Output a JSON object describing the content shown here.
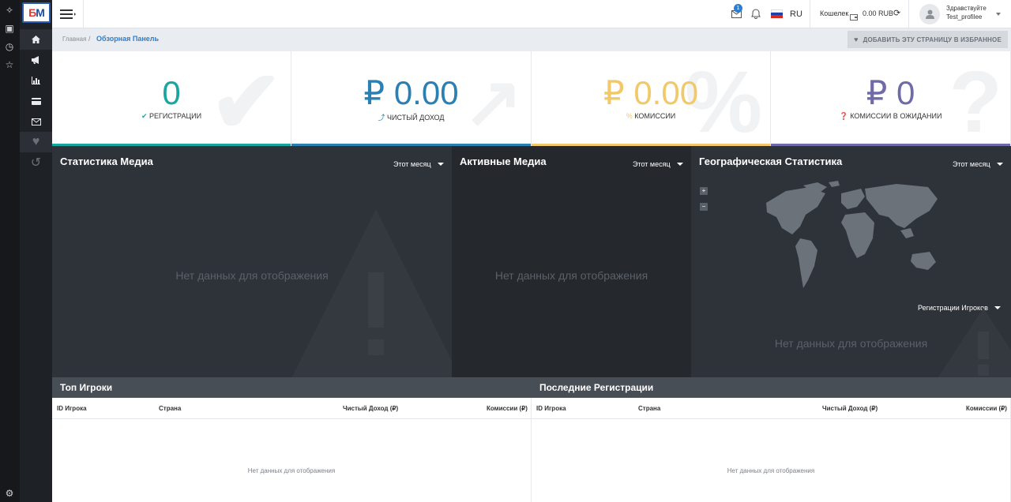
{
  "brand": {
    "logo_b": "Б",
    "logo_m": "M"
  },
  "topbar": {
    "mail_badge": "1",
    "language": "RU",
    "wallet_label": "Кошелек",
    "wallet_amount": "0.00 RUB",
    "greeting": "Здравствуйте",
    "username": "Test_profilee"
  },
  "breadcrumb": {
    "home": "Главная",
    "separator": "/",
    "current": "Обзорная Панель"
  },
  "favorite_button": "ДОБАВИТЬ ЭТУ СТРАНИЦУ В ИЗБРАННОЕ",
  "kpis": [
    {
      "value": "0",
      "label": "РЕГИСТРАЦИИ",
      "color": "#1aa6a0"
    },
    {
      "value": "₽ 0.00",
      "label": "ЧИСТЫЙ ДОХОД",
      "color": "#2a7fb3"
    },
    {
      "value": "₽ 0.00",
      "label": "КОМИССИИ",
      "color": "#f2c96a"
    },
    {
      "value": "₽ 0",
      "label": "КОМИССИИ В ОЖИДАНИИ",
      "color": "#6f6aa8"
    }
  ],
  "kpi_icons": {
    "reg": "✔",
    "income": "📈",
    "comm": "%",
    "pending": "?"
  },
  "panels": {
    "media_stats": {
      "title": "Статистика Медиа",
      "period": "Этот месяц",
      "empty": "Нет данных для отображения"
    },
    "active_media": {
      "title": "Активные Медиа",
      "period": "Этот месяц",
      "empty": "Нет данных для отображения"
    },
    "geo": {
      "title": "Географическая Статистика",
      "period": "Этот месяц",
      "zoom_in": "+",
      "zoom_out": "−",
      "metric": "Регистрации Игроков",
      "empty": "Нет данных для отображения"
    }
  },
  "tables": {
    "top_players": {
      "title": "Топ Игроки",
      "columns": [
        "ID Игрока",
        "Страна",
        "Чистый Доход (₽)",
        "Комиссии (₽)"
      ],
      "empty": "Нет данных для отображения"
    },
    "recent_regs": {
      "title": "Последние Регистрации",
      "columns": [
        "ID Игрока",
        "Страна",
        "Чистый Доход (₽)",
        "Комиссии (₽)"
      ],
      "empty": "Нет данных для отображения"
    }
  }
}
